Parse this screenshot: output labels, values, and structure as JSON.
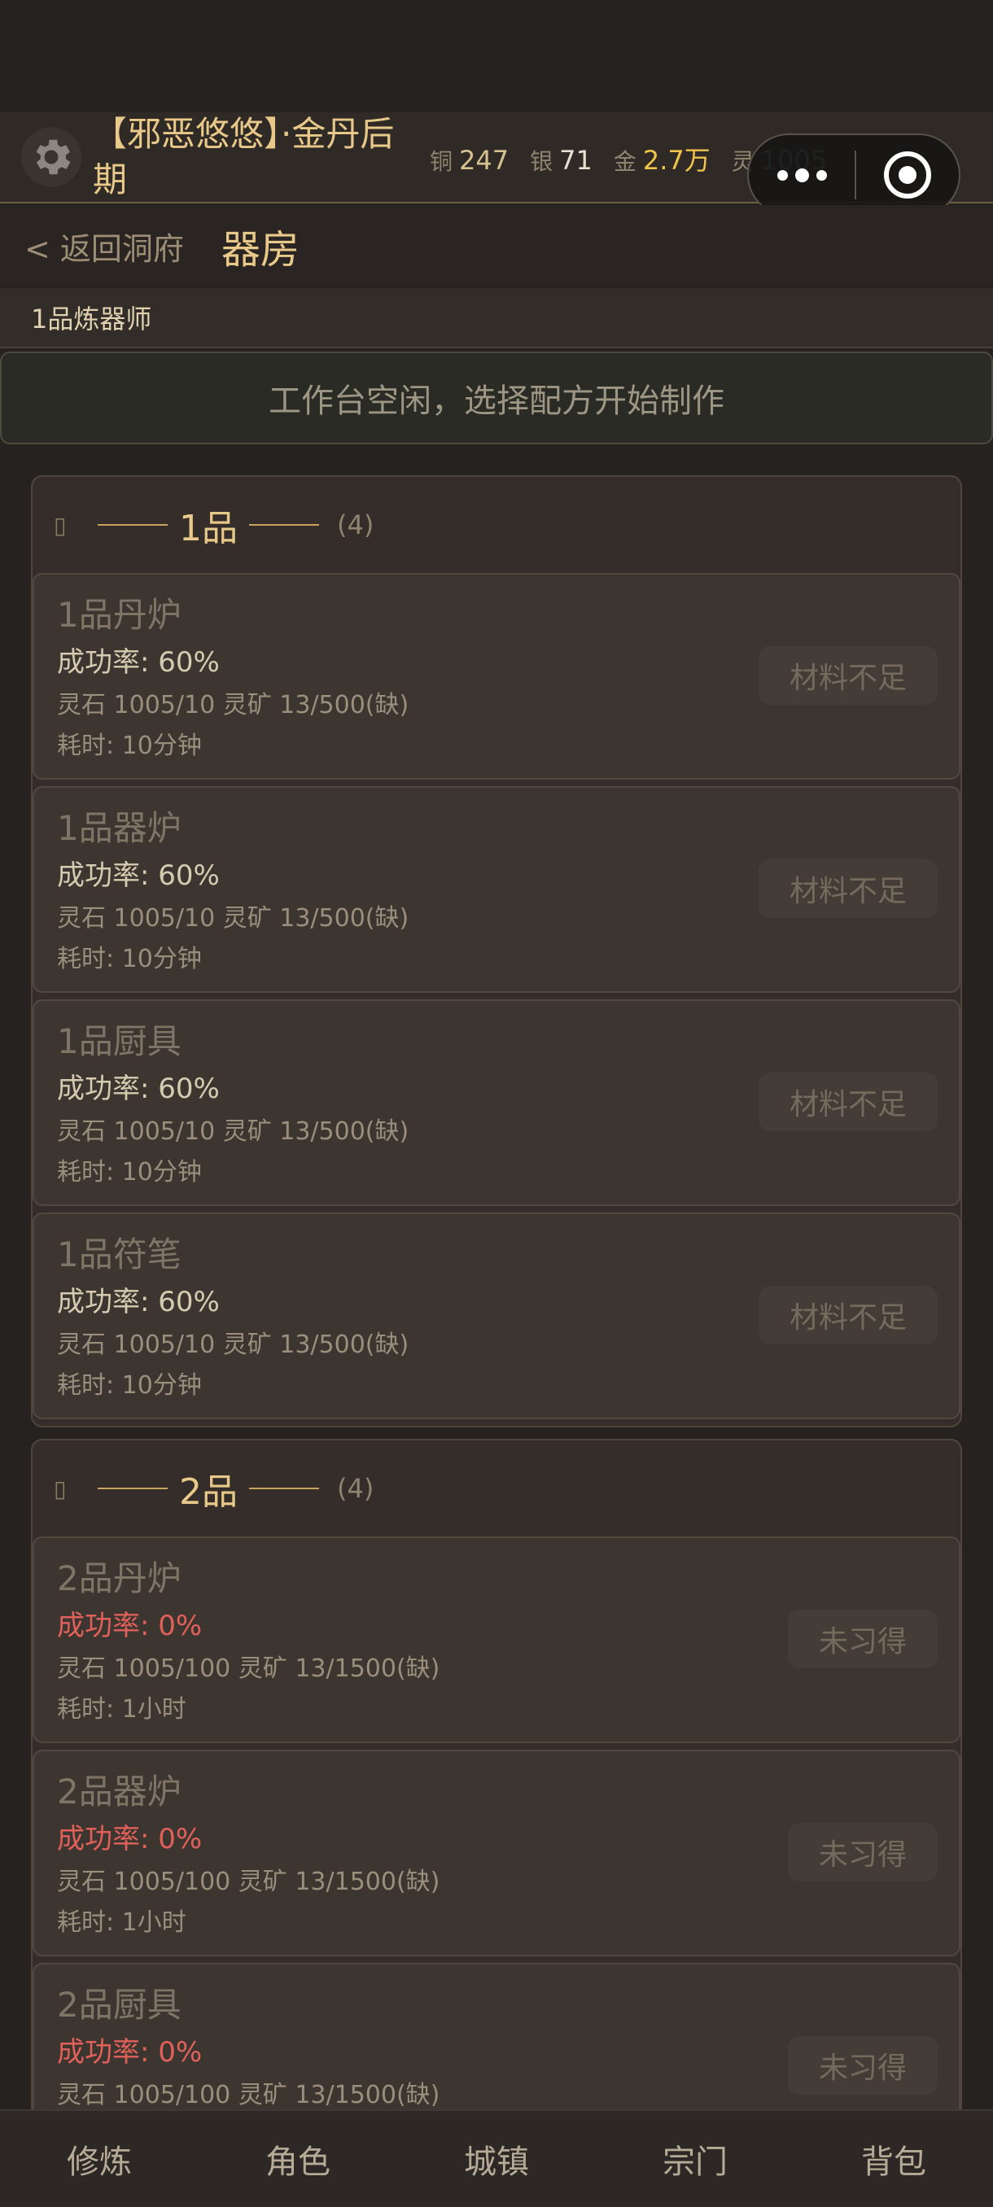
{
  "header": {
    "character": "【邪恶悠悠】·金丹后期",
    "currencies": [
      {
        "label": "铜",
        "value": "247"
      },
      {
        "label": "银",
        "value": "71"
      },
      {
        "label": "金",
        "value": "2.7万"
      },
      {
        "label": "灵",
        "value": "1005"
      }
    ]
  },
  "nav": {
    "back": "< 返回洞府",
    "title": "器房"
  },
  "rank": "1品炼器师",
  "workbench": "工作台空闲，选择配方开始制作",
  "groups": [
    {
      "title": "1品",
      "count": "(4)",
      "recipes": [
        {
          "name": "1品丹炉",
          "rate": "成功率: 60%",
          "cost": "灵石 1005/10  灵矿 13/500(缺)",
          "time": "耗时: 10分钟",
          "button": "材料不足"
        },
        {
          "name": "1品器炉",
          "rate": "成功率: 60%",
          "cost": "灵石 1005/10  灵矿 13/500(缺)",
          "time": "耗时: 10分钟",
          "button": "材料不足"
        },
        {
          "name": "1品厨具",
          "rate": "成功率: 60%",
          "cost": "灵石 1005/10  灵矿 13/500(缺)",
          "time": "耗时: 10分钟",
          "button": "材料不足"
        },
        {
          "name": "1品符笔",
          "rate": "成功率: 60%",
          "cost": "灵石 1005/10  灵矿 13/500(缺)",
          "time": "耗时: 10分钟",
          "button": "材料不足"
        }
      ]
    },
    {
      "title": "2品",
      "count": "(4)",
      "recipes": [
        {
          "name": "2品丹炉",
          "rate": "成功率: 0%",
          "cost": "灵石 1005/100  灵矿 13/1500(缺)",
          "time": "耗时: 1小时",
          "button": "未习得"
        },
        {
          "name": "2品器炉",
          "rate": "成功率: 0%",
          "cost": "灵石 1005/100  灵矿 13/1500(缺)",
          "time": "耗时: 1小时",
          "button": "未习得"
        },
        {
          "name": "2品厨具",
          "rate": "成功率: 0%",
          "cost": "灵石 1005/100  灵矿 13/1500(缺)",
          "time": "",
          "button": "未习得"
        }
      ]
    }
  ],
  "tabs": [
    "修炼",
    "角色",
    "城镇",
    "宗门",
    "背包"
  ],
  "colors": {
    "accent": "#e8c98a",
    "danger": "#e0605a",
    "gold": "#f0c34d",
    "spirit": "#6aa6c8"
  }
}
